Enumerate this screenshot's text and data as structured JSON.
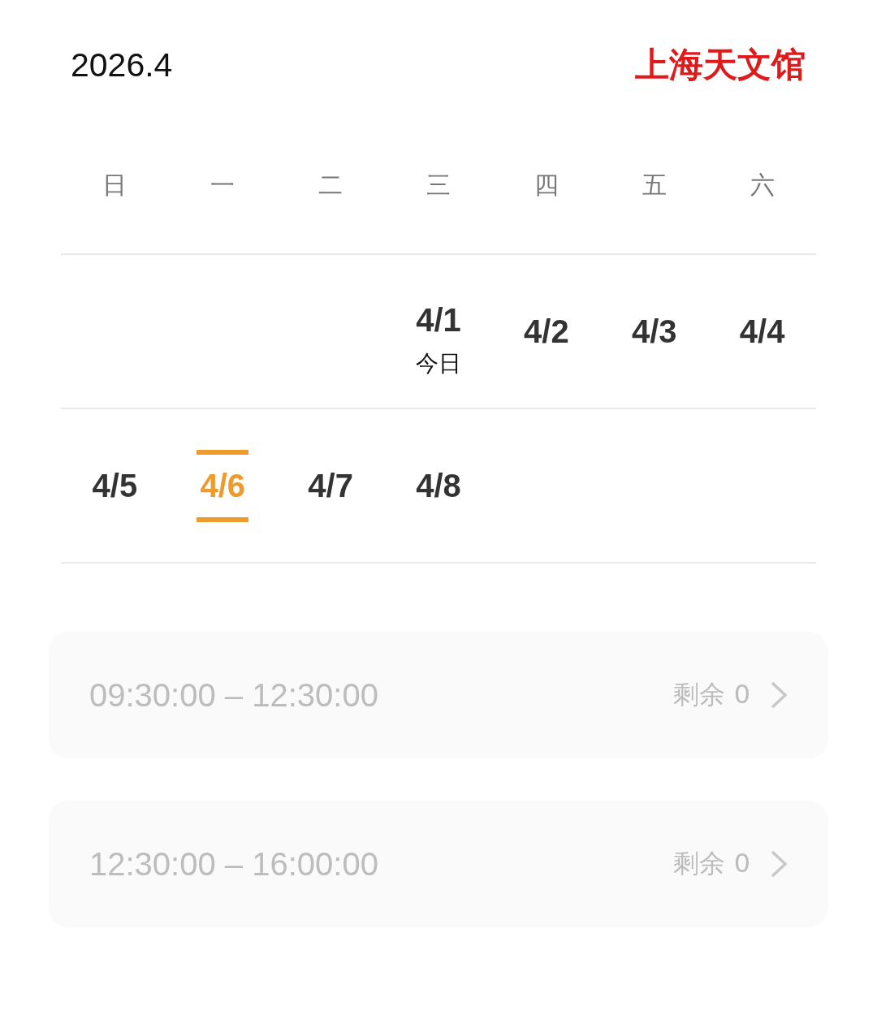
{
  "header": {
    "month": "2026.4",
    "venue": "上海天文馆"
  },
  "weekdays": [
    "日",
    "一",
    "二",
    "三",
    "四",
    "五",
    "六"
  ],
  "weeks": [
    [
      {
        "kind": "empty"
      },
      {
        "kind": "empty"
      },
      {
        "kind": "empty"
      },
      {
        "kind": "day",
        "date": "4/1",
        "note": "今日",
        "selected": false
      },
      {
        "kind": "day",
        "date": "4/2",
        "selected": false
      },
      {
        "kind": "day",
        "date": "4/3",
        "selected": false
      },
      {
        "kind": "day",
        "date": "4/4",
        "selected": false
      }
    ],
    [
      {
        "kind": "day",
        "date": "4/5",
        "selected": false
      },
      {
        "kind": "day",
        "date": "4/6",
        "selected": true
      },
      {
        "kind": "day",
        "date": "4/7",
        "selected": false
      },
      {
        "kind": "day",
        "date": "4/8",
        "selected": false
      }
    ]
  ],
  "slots": [
    {
      "time": "09:30:00 – 12:30:00",
      "remaining": "剩余 0",
      "disabled": true
    },
    {
      "time": "12:30:00 – 16:00:00",
      "remaining": "剩余 0",
      "disabled": true
    }
  ]
}
